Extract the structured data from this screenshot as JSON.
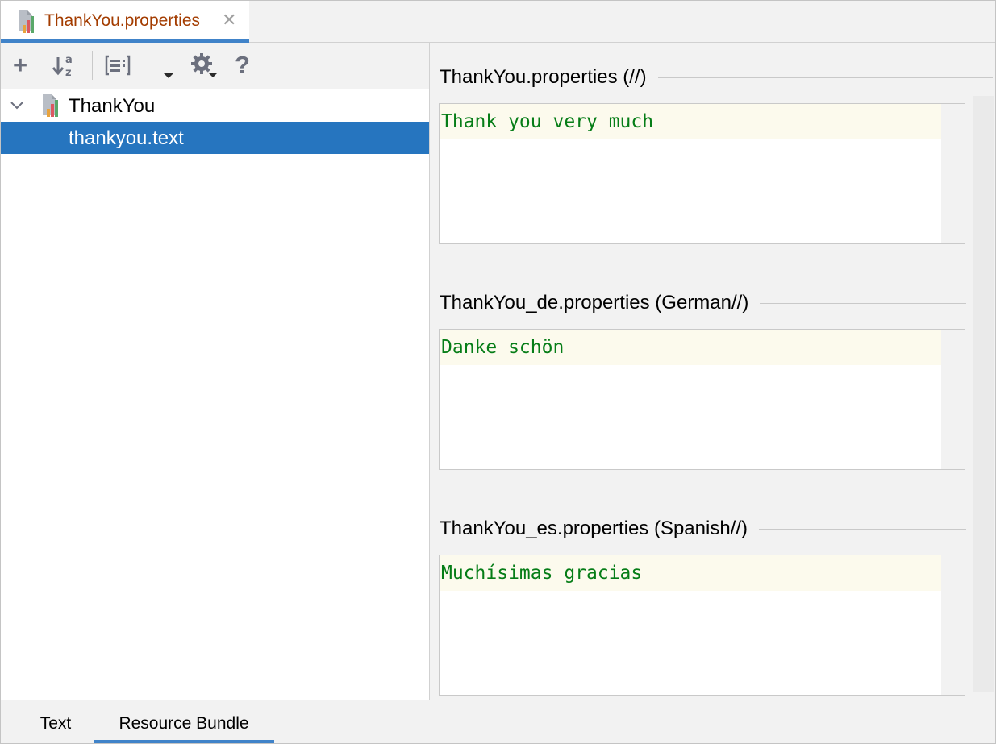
{
  "editor_tab": {
    "label": "ThankYou.properties",
    "close_glyph": "✕",
    "icon": "resource-bundle-icon"
  },
  "toolbar": {
    "add_glyph": "+",
    "help_glyph": "?",
    "buttons": [
      "add-icon",
      "sort-alphabetically-icon",
      "group-by-prefix-icon",
      "expand-dropdown-icon",
      "settings-icon",
      "help-icon"
    ]
  },
  "tree": {
    "root_label": "ThankYou",
    "child_label": "thankyou.text"
  },
  "editors": [
    {
      "title": "ThankYou.properties (//)",
      "value": "Thank you very much"
    },
    {
      "title": "ThankYou_de.properties (German//)",
      "value": "Danke schön"
    },
    {
      "title": "ThankYou_es.properties (Spanish//)",
      "value": "Muchísimas gracias"
    }
  ],
  "bottom_tabs": [
    {
      "label": "Text",
      "active": false
    },
    {
      "label": "Resource Bundle",
      "active": true
    }
  ],
  "colors": {
    "accent": "#4083c9",
    "selection": "#2675bf",
    "tab_text": "#a33c00",
    "value_text": "#067d17"
  }
}
